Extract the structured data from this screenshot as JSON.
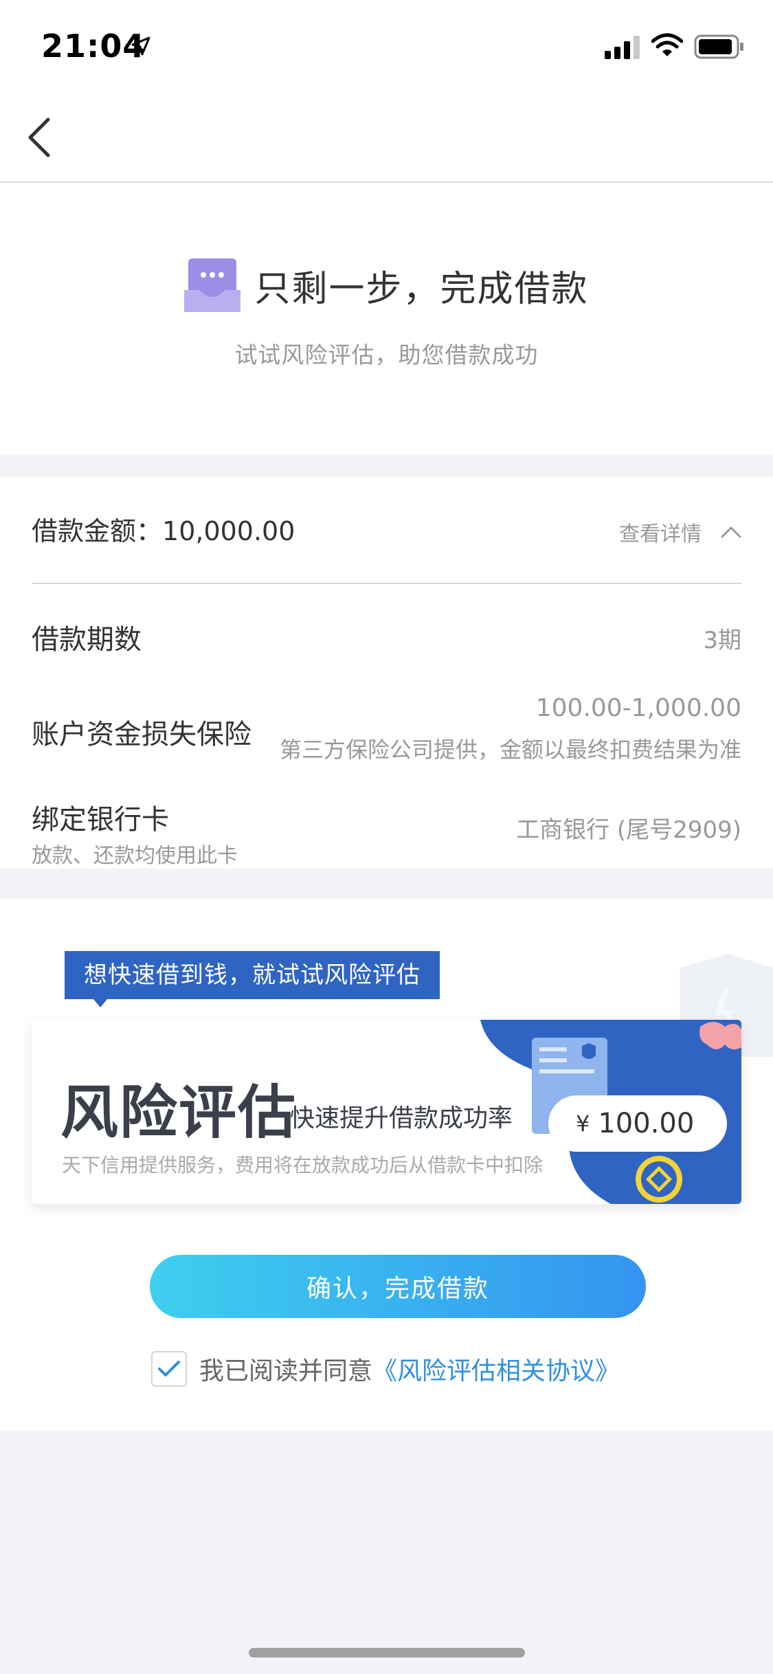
{
  "status_bar": {
    "time": "21:04"
  },
  "header": {
    "title": "只剩一步，完成借款",
    "subtitle": "试试风险评估，助您借款成功"
  },
  "details": {
    "amount_label": "借款金额：",
    "amount_value": "10,000.00",
    "view_details": "查看详情",
    "term_label": "借款期数",
    "term_value": "3期",
    "insurance_label": "账户资金损失保险",
    "insurance_value": "100.00-1,000.00",
    "insurance_note": "第三方保险公司提供，金额以最终扣费结果为准",
    "card_label": "绑定银行卡",
    "card_sub": "放款、还款均使用此卡",
    "card_value": "工商银行 (尾号2909)"
  },
  "risk": {
    "tooltip": "想快速借到钱，就试试风险评估",
    "title": "风险评估",
    "slogan": "快速提升借款成功率",
    "description": "天下信用提供服务，费用将在放款成功后从借款卡中扣除",
    "price_currency": "¥",
    "price_value": "100.00",
    "confirm_button": "确认，完成借款",
    "agree_text": "我已阅读并同意",
    "agree_link": "《风险评估相关协议》"
  },
  "colors": {
    "accent_blue": "#2f64c2",
    "button_start": "#3ecfef",
    "button_end": "#3494f0",
    "link": "#2f8fe0",
    "icon_purple": "#9b8ee6"
  },
  "icons": [
    "location-arrow-icon",
    "signal-icon",
    "wifi-icon",
    "battery-icon",
    "back-icon",
    "message-icon",
    "chevron-up-icon",
    "check-icon",
    "shield-icon",
    "coin-icon"
  ]
}
